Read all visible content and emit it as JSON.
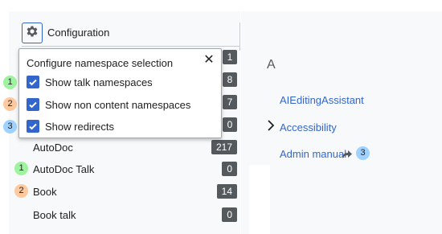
{
  "header": {
    "config_label": "Configuration"
  },
  "popup": {
    "title": "Configure namespace selection",
    "options": [
      {
        "label": "Show talk namespaces",
        "checked": true,
        "marker": "1"
      },
      {
        "label": "Show non content namespaces",
        "checked": true,
        "marker": "2"
      },
      {
        "label": "Show redirects",
        "checked": true,
        "marker": "3"
      }
    ]
  },
  "hidden_counts": [
    "1",
    "8",
    "7",
    "0"
  ],
  "namespaces": [
    {
      "name": "AutoDoc",
      "count": "217",
      "marker": ""
    },
    {
      "name": "AutoDoc Talk",
      "count": "0",
      "marker": "1"
    },
    {
      "name": "Book",
      "count": "14",
      "marker": "2"
    },
    {
      "name": "Book talk",
      "count": "0",
      "marker": ""
    }
  ],
  "pages": {
    "letter": "A",
    "items": [
      {
        "title": "AIEditingAssistant",
        "expandable": false
      },
      {
        "title": "Accessibility",
        "expandable": true
      },
      {
        "title": "Admin manual",
        "redirect": true,
        "marker": "3"
      }
    ]
  },
  "colors": {
    "accent": "#3366cc",
    "badge": "#54595d",
    "marker_talk": "#9ff29f",
    "marker_noncontent": "#ffc99f",
    "marker_redirect": "#9fd2ff"
  }
}
